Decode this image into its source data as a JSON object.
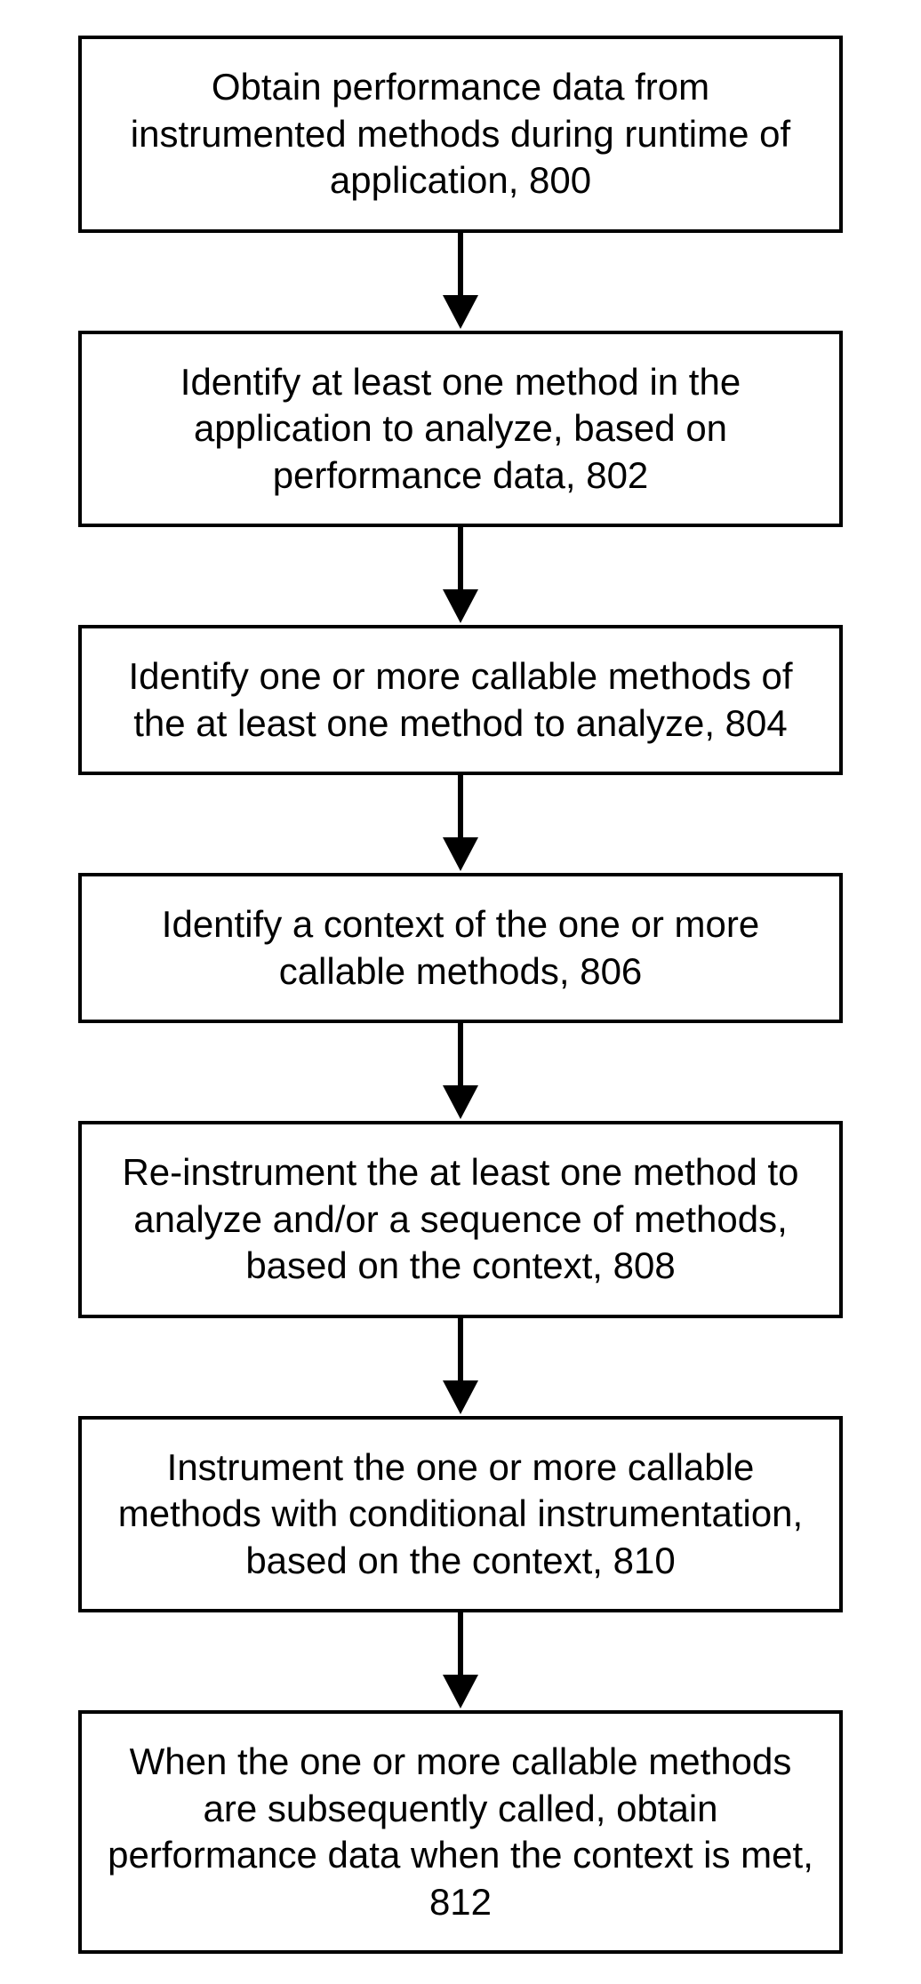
{
  "flow": {
    "nodes": [
      {
        "id": 800,
        "text": "Obtain performance data from instrumented methods during runtime of application, 800"
      },
      {
        "id": 802,
        "text": "Identify at least one method in the application to analyze, based on performance data, 802"
      },
      {
        "id": 804,
        "text": "Identify one or more callable methods of the at least one method to analyze, 804"
      },
      {
        "id": 806,
        "text": "Identify a context of the one or more callable methods, 806"
      },
      {
        "id": 808,
        "text": "Re-instrument the at least one method to analyze and/or a sequence of methods, based on the context, 808"
      },
      {
        "id": 810,
        "text": "Instrument the one or more callable methods with conditional instrumentation, based on the context, 810"
      },
      {
        "id": 812,
        "text": "When the one or more callable methods are subsequently called, obtain performance data when the context is met, 812"
      }
    ]
  }
}
